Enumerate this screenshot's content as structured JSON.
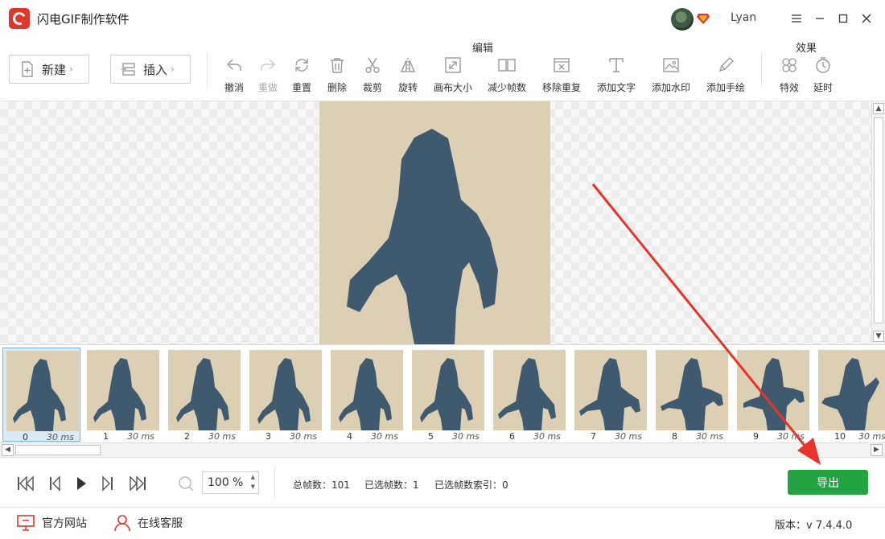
{
  "app": {
    "title": "闪电GIF制作软件",
    "username": "Lyan",
    "accent_red": "#e0352b",
    "export_green": "#23a342"
  },
  "toolbar": {
    "new_label": "新建",
    "insert_label": "插入",
    "edit_group": "编辑",
    "effect_group": "效果",
    "tools": [
      {
        "label": "撤消",
        "icon": "undo-icon",
        "enabled": true
      },
      {
        "label": "重做",
        "icon": "redo-icon",
        "enabled": false
      },
      {
        "label": "重置",
        "icon": "reset-icon",
        "enabled": true
      },
      {
        "label": "删除",
        "icon": "trash-icon",
        "enabled": true
      },
      {
        "label": "裁剪",
        "icon": "scissors-icon",
        "enabled": true
      },
      {
        "label": "旋转",
        "icon": "flip-icon",
        "enabled": true
      },
      {
        "label": "画布大小",
        "icon": "resize-icon",
        "enabled": true
      },
      {
        "label": "减少帧数",
        "icon": "reduce-frames-icon",
        "enabled": true
      },
      {
        "label": "移除重复",
        "icon": "remove-duplicate-icon",
        "enabled": true
      },
      {
        "label": "添加文字",
        "icon": "text-icon",
        "enabled": true
      },
      {
        "label": "添加水印",
        "icon": "watermark-icon",
        "enabled": true
      },
      {
        "label": "添加手绘",
        "icon": "pencil-icon",
        "enabled": true
      },
      {
        "label": "特效",
        "icon": "effects-icon",
        "enabled": true
      },
      {
        "label": "延时",
        "icon": "timer-icon",
        "enabled": true
      }
    ]
  },
  "frames": [
    {
      "index": "0",
      "duration": "30 ms",
      "selected": true
    },
    {
      "index": "1",
      "duration": "30 ms"
    },
    {
      "index": "2",
      "duration": "30 ms"
    },
    {
      "index": "3",
      "duration": "30 ms"
    },
    {
      "index": "4",
      "duration": "30 ms"
    },
    {
      "index": "5",
      "duration": "30 ms"
    },
    {
      "index": "6",
      "duration": "30 ms"
    },
    {
      "index": "7",
      "duration": "30 ms"
    },
    {
      "index": "8",
      "duration": "30 ms"
    },
    {
      "index": "9",
      "duration": "30 ms"
    },
    {
      "index": "10",
      "duration": "30 ms"
    }
  ],
  "playback": {
    "zoom_value": "100",
    "zoom_unit": "%",
    "total_frames": "总帧数：101",
    "selected_frames": "已选帧数：1",
    "selected_index": "已选帧数索引：0",
    "export_label": "导出"
  },
  "footer": {
    "website": "官方网站",
    "support": "在线客服",
    "version": "版本：v 7.4.4.0"
  }
}
